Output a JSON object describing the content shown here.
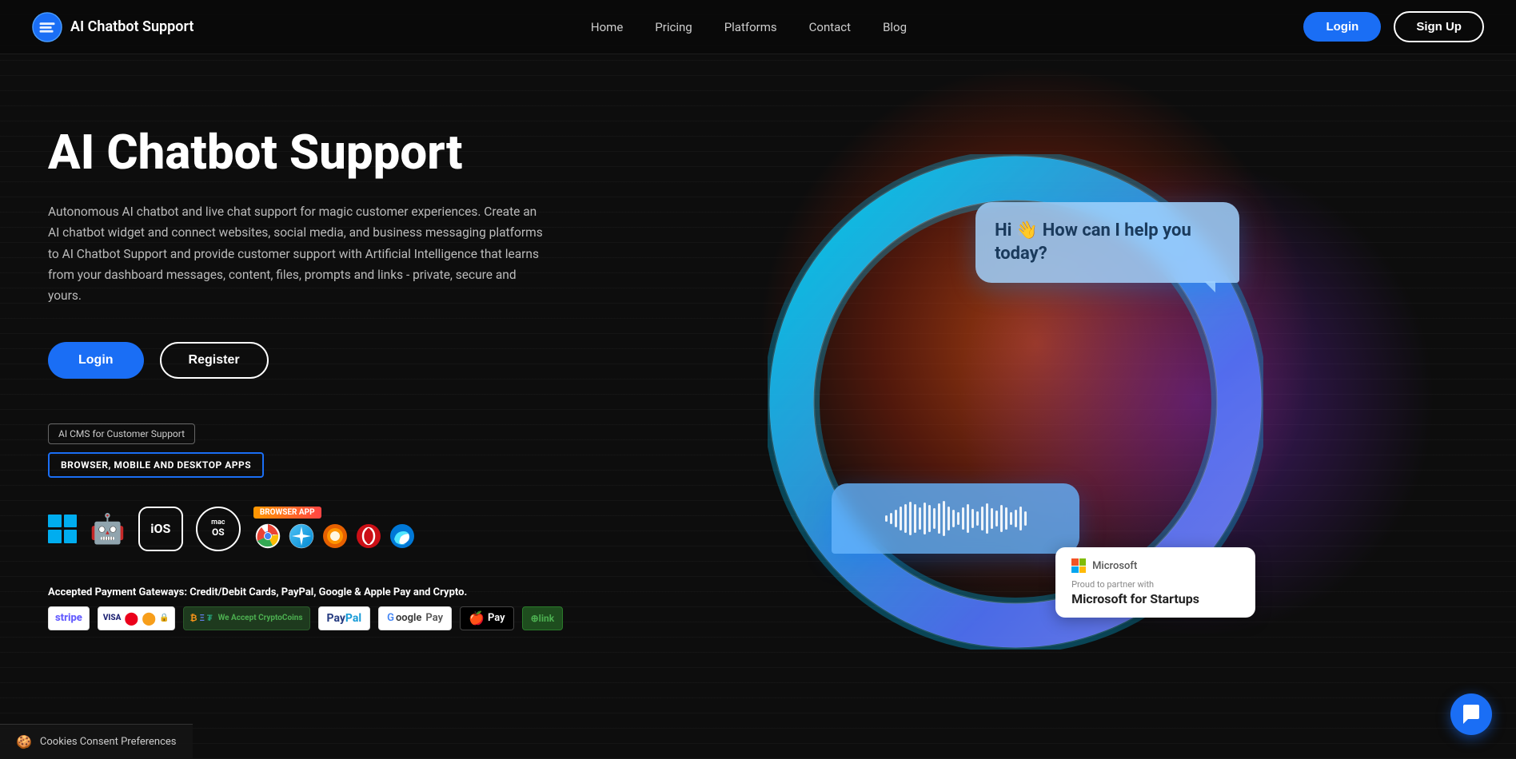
{
  "nav": {
    "brand": "AI Chatbot Support",
    "links": [
      {
        "label": "Home",
        "id": "home"
      },
      {
        "label": "Pricing",
        "id": "pricing"
      },
      {
        "label": "Platforms",
        "id": "platforms"
      },
      {
        "label": "Contact",
        "id": "contact"
      },
      {
        "label": "Blog",
        "id": "blog"
      }
    ],
    "login_label": "Login",
    "signup_label": "Sign Up"
  },
  "hero": {
    "title": "AI Chatbot Support",
    "description": "Autonomous AI chatbot and live chat support for magic customer experiences. Create an AI chatbot widget and connect websites, social media, and business messaging platforms to AI Chatbot Support and provide customer support with Artificial Intelligence that learns from your dashboard messages, content, files, prompts and links - private, secure and yours.",
    "login_label": "Login",
    "register_label": "Register",
    "cms_badge": "AI CMS for Customer Support",
    "platforms_badge": "BROWSER, MOBILE AND DESKTOP APPS",
    "chat_greeting": "Hi 👋 How can I help you today?",
    "payment_label": "Accepted Payment Gateways:",
    "payment_desc": "Credit/Debit Cards, PayPal, Google & Apple Pay and Crypto."
  },
  "microsoft": {
    "company": "Microsoft",
    "proud_text": "Proud to partner with",
    "partner_name": "Microsoft for Startups"
  },
  "cookie": {
    "text": "Cookies Consent Preferences"
  },
  "audio_bars": [
    8,
    14,
    22,
    30,
    36,
    42,
    36,
    28,
    40,
    34,
    26,
    38,
    44,
    30,
    22,
    16,
    28,
    36,
    24,
    18,
    30,
    38,
    26,
    20,
    34,
    28,
    16,
    22,
    30,
    18
  ]
}
